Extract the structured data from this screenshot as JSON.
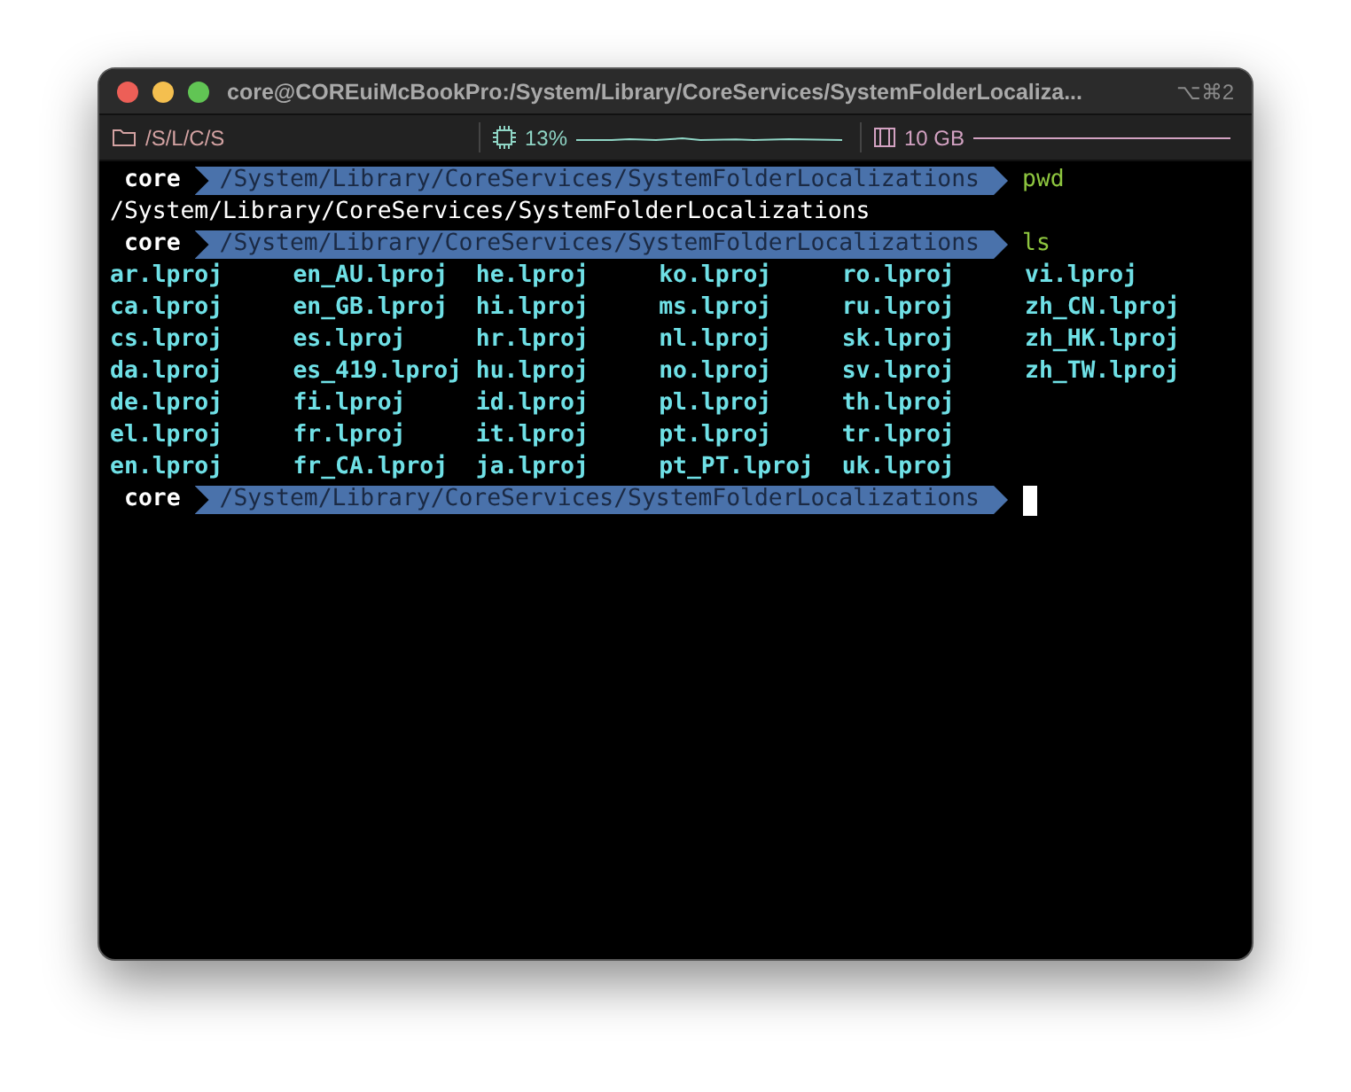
{
  "window": {
    "title": "core@COREuiMcBookPro:/System/Library/CoreServices/SystemFolderLocaliza...",
    "shortcut": "⌥⌘2"
  },
  "status_bar": {
    "directory": "/S/L/C/S",
    "cpu": "13%",
    "memory": "10 GB"
  },
  "lines": [
    {
      "kind": "prompt",
      "user": "core",
      "path": "/System/Library/CoreServices/SystemFolderLocalizations",
      "command": "pwd"
    },
    {
      "kind": "output",
      "text": "/System/Library/CoreServices/SystemFolderLocalizations"
    },
    {
      "kind": "prompt",
      "user": "core",
      "path": "/System/Library/CoreServices/SystemFolderLocalizations",
      "command": "ls"
    },
    {
      "kind": "listing",
      "items": [
        "ar.lproj",
        "ca.lproj",
        "cs.lproj",
        "da.lproj",
        "de.lproj",
        "el.lproj",
        "en.lproj",
        "en_AU.lproj",
        "en_GB.lproj",
        "es.lproj",
        "es_419.lproj",
        "fi.lproj",
        "fr.lproj",
        "fr_CA.lproj",
        "he.lproj",
        "hi.lproj",
        "hr.lproj",
        "hu.lproj",
        "id.lproj",
        "it.lproj",
        "ja.lproj",
        "ko.lproj",
        "ms.lproj",
        "nl.lproj",
        "no.lproj",
        "pl.lproj",
        "pt.lproj",
        "pt_PT.lproj",
        "ro.lproj",
        "ru.lproj",
        "sk.lproj",
        "sv.lproj",
        "th.lproj",
        "tr.lproj",
        "uk.lproj",
        "vi.lproj",
        "zh_CN.lproj",
        "zh_HK.lproj",
        "zh_TW.lproj"
      ]
    },
    {
      "kind": "prompt",
      "user": "core",
      "path": "/System/Library/CoreServices/SystemFolderLocalizations",
      "cursor": true
    }
  ]
}
